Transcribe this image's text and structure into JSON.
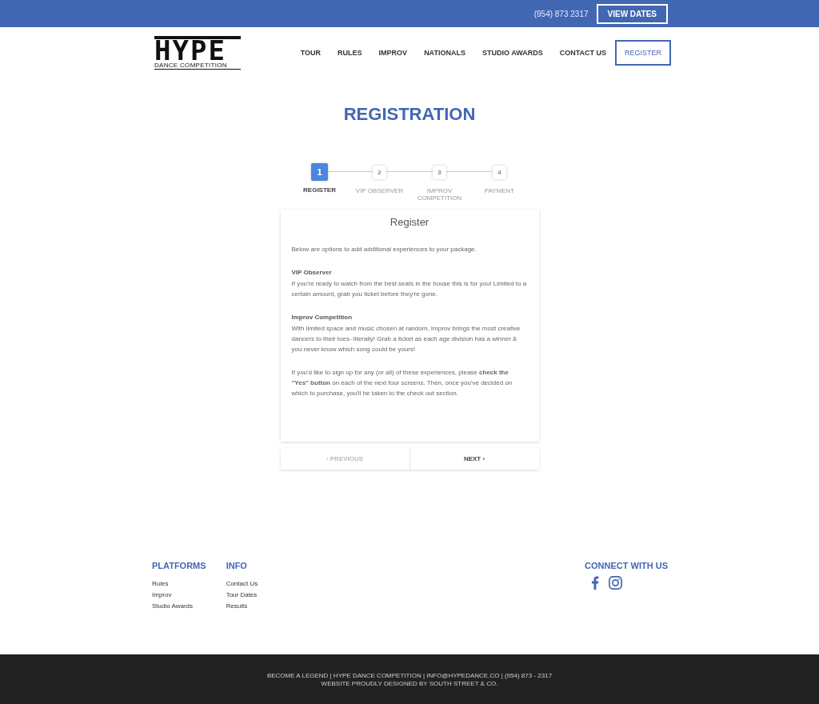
{
  "top_bar": {
    "phone": "(954) 873 2317",
    "button": "VIEW DATES"
  },
  "logo": {
    "title": "HYPE",
    "subtitle": "DANCE COMPETITION"
  },
  "nav": [
    {
      "label": "TOUR",
      "kind": "link"
    },
    {
      "label": "RULES",
      "kind": "link"
    },
    {
      "label": "IMPROV",
      "kind": "link"
    },
    {
      "label": "NATIONALS",
      "kind": "link"
    },
    {
      "label": "STUDIO AWARDS",
      "kind": "link"
    },
    {
      "label": "CONTACT US",
      "kind": "link"
    },
    {
      "label": "REGISTER",
      "kind": "button"
    }
  ],
  "page_title": "REGISTRATION",
  "steps": [
    {
      "number": "1",
      "label": "REGISTER",
      "selected": true
    },
    {
      "number": "2",
      "label": "VIP OBSERVER",
      "selected": false
    },
    {
      "number": "3",
      "label": "IMPROV COMPETITION",
      "selected": false
    },
    {
      "number": "4",
      "label": "PAYMENT",
      "selected": false
    }
  ],
  "card": {
    "title": "Register",
    "intro": "Below are options to add additional experiences to your package.",
    "sections": [
      {
        "heading": "VIP Observer",
        "text": "If you're ready to watch from the best seats in the house this is for you! Limited to a certain amount, grab you ticket before they're gone."
      },
      {
        "heading": "Improv Competition",
        "text": "With limited space and music chosen at random, Improv brings the most creative dancers to their toes- literally! Grab a ticket as each age division has a winner & you never know which song could be yours!"
      }
    ],
    "note": "If you'd like to sign up for any (or all) of these experiences, please **check the \"Yes\" button** on each of the next four screens. Then, once you've decided on which to purchase, you'll be taken to the check out section."
  },
  "pager": [
    {
      "label": "‹ PREVIOUS",
      "disabled": true
    },
    {
      "label": "NEXT ›",
      "disabled": false
    }
  ],
  "footer": {
    "columns": [
      {
        "heading": "PLATFORMS",
        "links": [
          "Rules",
          "Improv",
          "Studio Awards"
        ]
      },
      {
        "heading": "INFO",
        "links": [
          "Contact Us",
          "Tour Dates",
          "Results"
        ]
      }
    ],
    "connect": {
      "heading": "CONNECT WITH US",
      "icons": [
        {
          "kind": "facebook"
        },
        {
          "kind": "instagram"
        }
      ]
    }
  },
  "bottom": {
    "lines": [
      "BECOME A LEGEND | HYPE DANCE COMPETITION | INFO@HYPEDANCE.CO | (954) 873 - 2317",
      "WEBSITE PROUDLY DESIGNED BY SOUTH STREET & CO."
    ]
  }
}
